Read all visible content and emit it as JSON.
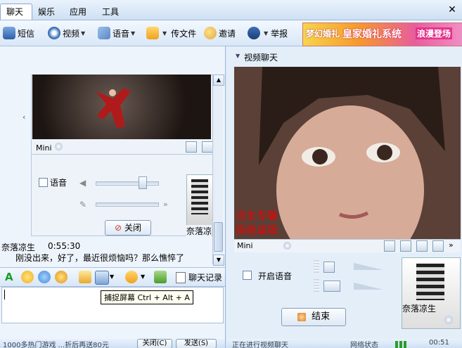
{
  "menu": {
    "items": [
      {
        "label": "聊天",
        "active": true
      },
      {
        "label": "娱乐",
        "active": false
      },
      {
        "label": "应用",
        "active": false
      },
      {
        "label": "工具",
        "active": false
      }
    ]
  },
  "toolbar": {
    "items": [
      {
        "label": "短信",
        "icon": "phone-icon"
      },
      {
        "label": "视频",
        "icon": "webcam-icon"
      },
      {
        "label": "语音",
        "icon": "microphone-icon"
      },
      {
        "label": "传文件",
        "icon": "file-transfer-icon"
      },
      {
        "label": "邀请",
        "icon": "invite-icon"
      },
      {
        "label": "举报",
        "icon": "police-icon"
      }
    ],
    "banner": {
      "brand": "梦幻婚礼",
      "title": "皇家婚礼系统",
      "tagline": "浪漫登场"
    }
  },
  "left_video": {
    "mini_label": "Mini",
    "voice_label": "语音",
    "close_label": "关闭",
    "thumb_name": "奈落凉"
  },
  "chat": {
    "sender": "奈落凉生",
    "time": "0:55:30",
    "message": "刚没出来，好了，最近很烦恼吗？那么憔悴了"
  },
  "format_bar": {
    "history_label": "聊天记录",
    "tooltip": "捕捉屏幕 Ctrl + Alt + A"
  },
  "status_left": {
    "text": "1000多热门游戏 ...折后再送80元",
    "close_btn": "关闭(C)",
    "send_btn": "发送(S)"
  },
  "right_video": {
    "panel_title": "视频聊天",
    "watermark_line1": "凉生专署",
    "watermark_line2": "拒绝盗版",
    "mini_label": "Mini",
    "enable_voice_label": "开启语音",
    "end_label": "结束",
    "thumb_name": "奈落凉生"
  },
  "status_right": {
    "text": "正在进行视频聊天",
    "net_label": "网络状态",
    "time": "00:51"
  },
  "colors": {
    "accent": "#316ac5",
    "watermark": "#e00000"
  }
}
